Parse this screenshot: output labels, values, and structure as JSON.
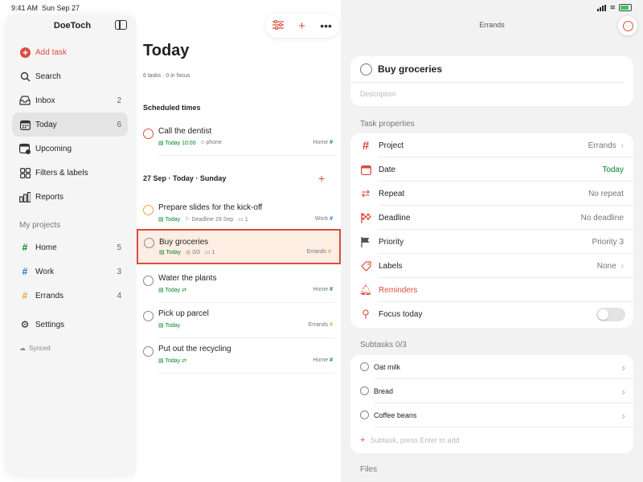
{
  "status": {
    "time": "9:41 AM",
    "date": "Sun Sep 27"
  },
  "sidebar": {
    "app_title": "DoeToch",
    "add_task": "Add task",
    "search": "Search",
    "inbox": {
      "label": "Inbox",
      "count": "2"
    },
    "today": {
      "label": "Today",
      "count": "6"
    },
    "upcoming": "Upcoming",
    "filters": "Filters & labels",
    "reports": "Reports",
    "projects_heading": "My projects",
    "projects": [
      {
        "label": "Home",
        "count": "5"
      },
      {
        "label": "Work",
        "count": "3"
      },
      {
        "label": "Errands",
        "count": "4"
      }
    ],
    "settings": "Settings",
    "synced": "Synced"
  },
  "list": {
    "title": "Today",
    "subtitle": "6 tasks · 0 in focus",
    "section_scheduled": "Scheduled times",
    "section_day": "27 Sep · Today · Sunday",
    "tasks": [
      {
        "name": "Call the dentist",
        "due": "Today 10:00",
        "extra": "phone",
        "project": "Home"
      },
      {
        "name": "Prepare slides for the kick-off",
        "due": "Today",
        "extra": "Deadline 29 Sep",
        "comments": "1",
        "project": "Work"
      },
      {
        "name": "Buy groceries",
        "due": "Today",
        "extra": "0/3",
        "comments": "1",
        "project": "Errands"
      },
      {
        "name": "Water the plants",
        "due": "Today",
        "project": "Home"
      },
      {
        "name": "Pick up parcel",
        "due": "Today",
        "project": "Errands"
      },
      {
        "name": "Put out the recycling",
        "due": "Today",
        "project": "Home"
      }
    ]
  },
  "detail": {
    "header": "Errands",
    "title": "Buy groceries",
    "description_placeholder": "Description",
    "props_heading": "Task properties",
    "props": {
      "project": {
        "label": "Project",
        "value": "Errands"
      },
      "date": {
        "label": "Date",
        "value": "Today"
      },
      "repeat": {
        "label": "Repeat",
        "value": "No repeat"
      },
      "deadline": {
        "label": "Deadline",
        "value": "No deadline"
      },
      "priority": {
        "label": "Priority",
        "value": "Priority 3"
      },
      "labels": {
        "label": "Labels",
        "value": "None"
      },
      "reminders": {
        "label": "Reminders"
      },
      "focus": {
        "label": "Focus today"
      }
    },
    "subtasks_heading": "Subtasks 0/3",
    "subtasks": [
      "Oat milk",
      "Bread",
      "Coffee beans"
    ],
    "subtask_placeholder": "Subtask, press Enter to add",
    "files_heading": "Files"
  },
  "colors": {
    "accent": "#dc4c3e",
    "today_green": "#058527",
    "work_blue": "#246fe0",
    "errands_orange": "#e8a33c"
  }
}
